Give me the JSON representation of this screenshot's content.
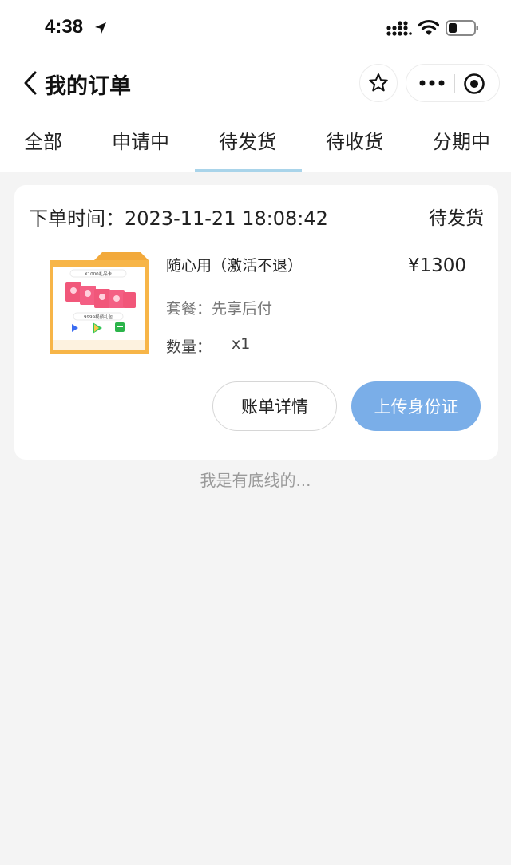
{
  "status_bar": {
    "time": "4:38"
  },
  "nav": {
    "back_glyph": "<",
    "title": "我的订单"
  },
  "tabs": [
    {
      "label": "全部"
    },
    {
      "label": "申请中"
    },
    {
      "label": "待发货",
      "active": true
    },
    {
      "label": "待收货"
    },
    {
      "label": "分期中"
    }
  ],
  "order": {
    "time": "下单时间：2023-11-21 18:08:42",
    "status": "待发货",
    "product": {
      "name": "随心用（激活不退）",
      "price": "¥1300",
      "plan": "套餐：先享后付",
      "quantity_label": "数量：",
      "quantity": "x1",
      "image_text_top": "X1000礼品卡",
      "image_text_mid": "9999视频礼包"
    },
    "buttons": {
      "bill": "账单详情",
      "upload": "上传身份证"
    }
  },
  "footer": {
    "text": "我是有底线的..."
  },
  "colors": {
    "accent": "#7aaee8",
    "tab_indicator": "#a9d4ea",
    "background": "#f4f4f4"
  },
  "icons": [
    "location-arrow-icon",
    "signal-icon",
    "wifi-icon",
    "battery-icon",
    "back-chevron-icon",
    "star-icon",
    "more-dots-icon",
    "target-circle-icon"
  ]
}
